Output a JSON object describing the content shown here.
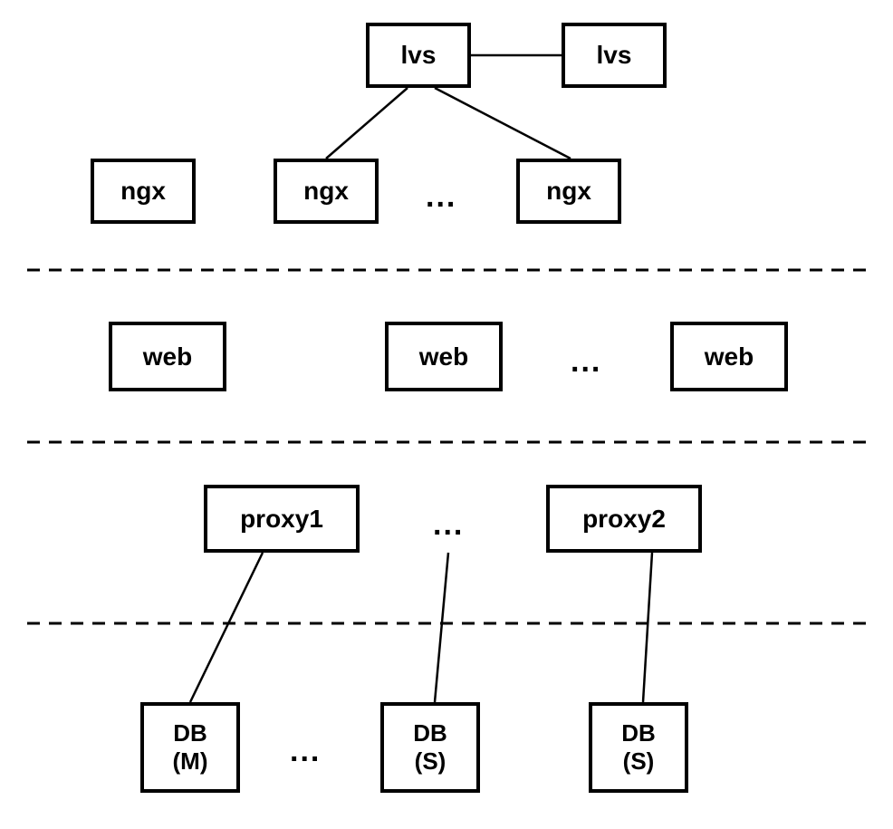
{
  "nodes": {
    "lvs1": "lvs",
    "lvs2": "lvs",
    "ngx1": "ngx",
    "ngx2": "ngx",
    "ngx3": "ngx",
    "web1": "web",
    "web2": "web",
    "web3": "web",
    "proxy1": "proxy1",
    "proxy2": "proxy2",
    "db1": "DB\n(M)",
    "db2": "DB\n(S)",
    "db3": "DB\n(S)"
  },
  "ellipsis": {
    "e1": "...",
    "e2": "...",
    "e3": "...",
    "e4": "..."
  }
}
